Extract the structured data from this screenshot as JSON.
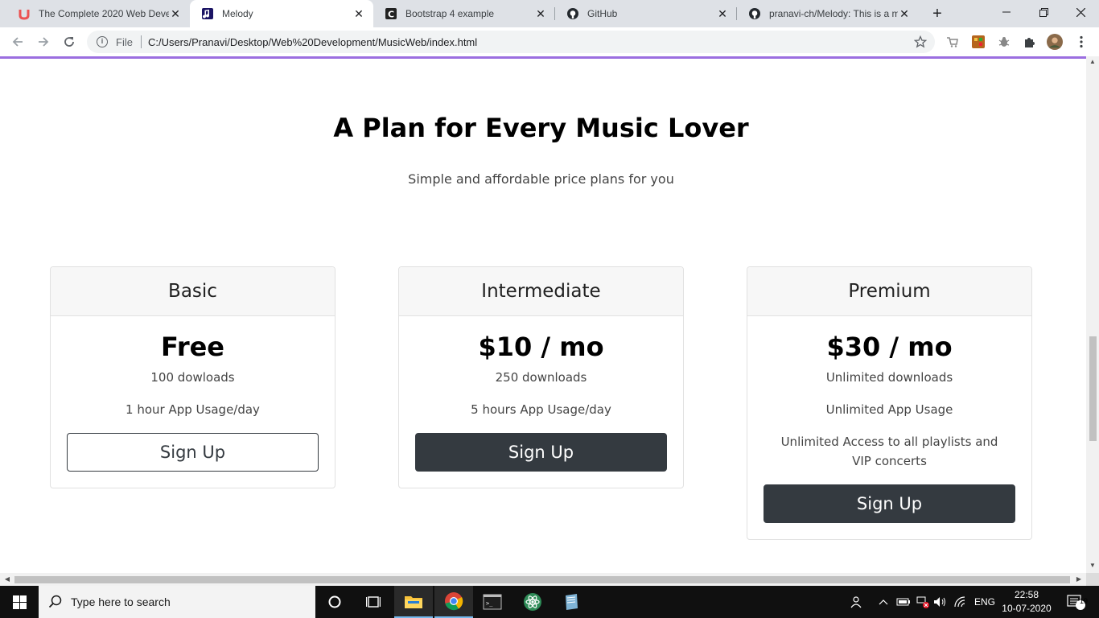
{
  "browser": {
    "tabs": [
      {
        "title": "The Complete 2020 Web Devel",
        "icon": "udemy-icon"
      },
      {
        "title": "Melody",
        "icon": "music-note-icon",
        "active": true
      },
      {
        "title": "Bootstrap 4 example",
        "icon": "c-logo-icon"
      },
      {
        "title": "GitHub",
        "icon": "github-icon"
      },
      {
        "title": "pranavi-ch/Melody: This is a m",
        "icon": "github-icon"
      }
    ],
    "tab_close": "✕",
    "new_tab": "+",
    "address": {
      "file_label": "File",
      "url": "C:/Users/Pranavi/Desktop/Web%20Development/MusicWeb/index.html"
    }
  },
  "page": {
    "heading": "A Plan for Every Music Lover",
    "subheading": "Simple and affordable price plans for you",
    "plans": [
      {
        "name": "Basic",
        "price": "Free",
        "features": [
          "100 dowloads",
          "1 hour App Usage/day"
        ],
        "button": "Sign Up",
        "button_style": "outline"
      },
      {
        "name": "Intermediate",
        "price": "$10 / mo",
        "features": [
          "250 downloads",
          "5 hours App Usage/day"
        ],
        "button": "Sign Up",
        "button_style": "dark"
      },
      {
        "name": "Premium",
        "price": "$30 / mo",
        "features": [
          "Unlimited downloads",
          "Unlimited App Usage",
          "Unlimited Access to all playlists and VIP concerts"
        ],
        "button": "Sign Up",
        "button_style": "dark"
      }
    ]
  },
  "taskbar": {
    "search_placeholder": "Type here to search",
    "language": "ENG",
    "time": "22:58",
    "date": "10-07-2020",
    "notification_count": "19"
  },
  "colors": {
    "accent_line": "#9b6ee0",
    "dark_button": "#343a40",
    "taskbar": "#101010"
  }
}
